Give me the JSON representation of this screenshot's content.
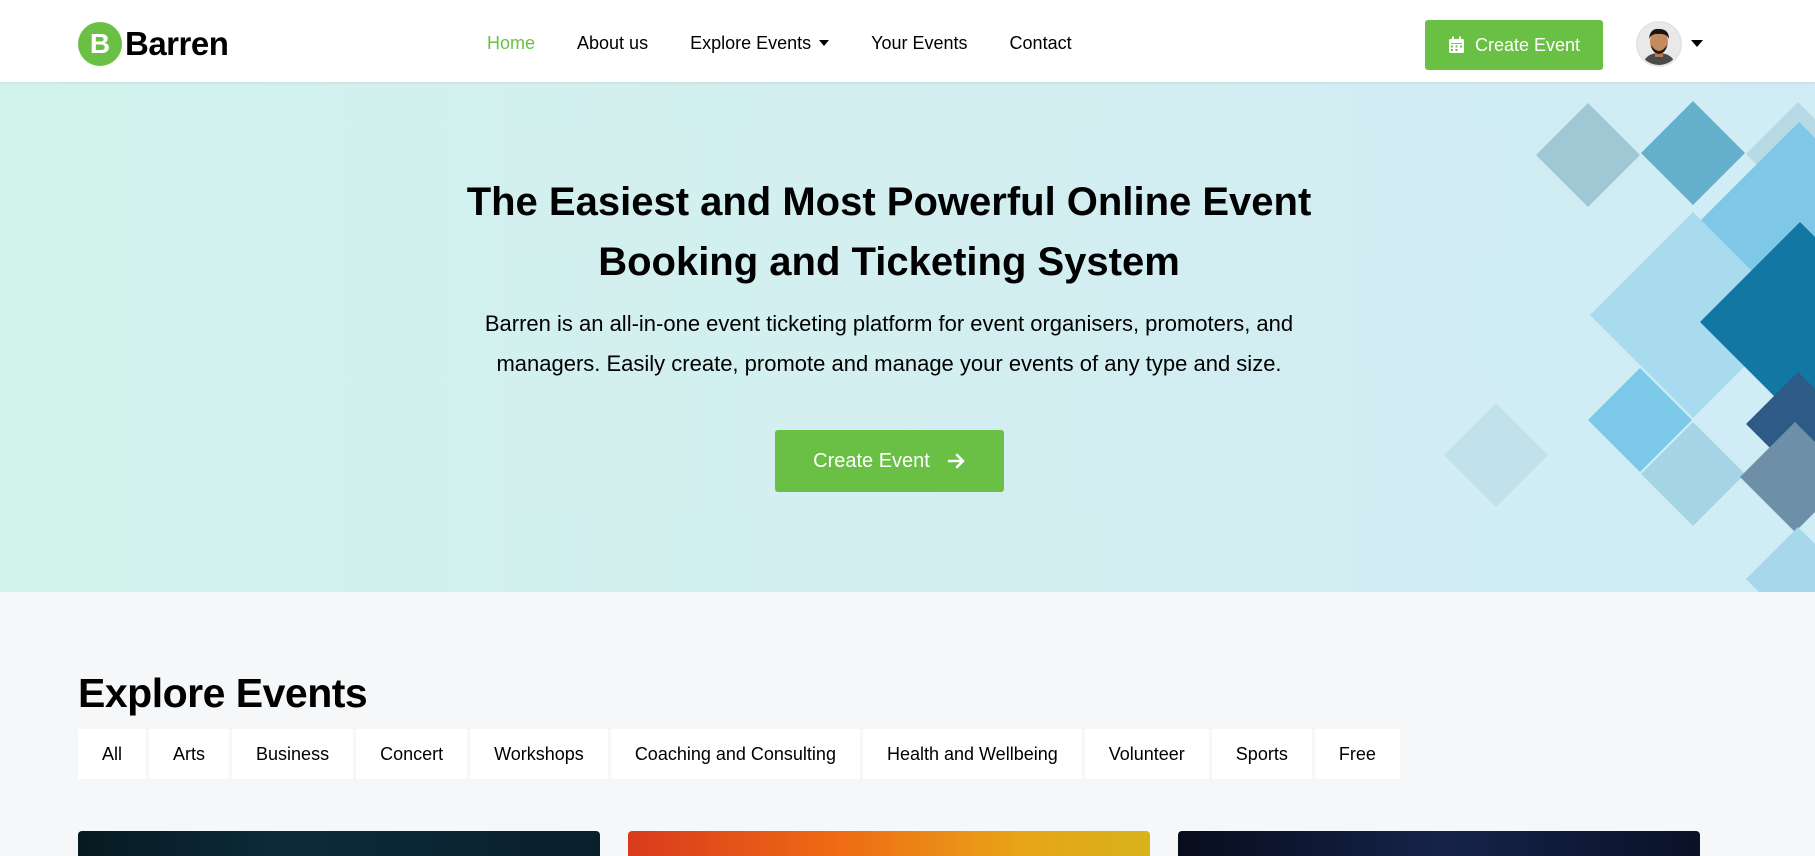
{
  "brand": {
    "logo_letter": "B",
    "name": "Barren",
    "accent": "#6ac045"
  },
  "nav": {
    "items": [
      {
        "label": "Home",
        "active": true
      },
      {
        "label": "About us"
      },
      {
        "label": "Explore Events",
        "dropdown": true
      },
      {
        "label": "Your Events"
      },
      {
        "label": "Contact"
      }
    ]
  },
  "header": {
    "create_label": "Create Event",
    "create_icon": "calendar-icon",
    "avatar": "user-avatar"
  },
  "hero": {
    "title_line1": "The Easiest and Most Powerful Online Event",
    "title_line2": "Booking and Ticketing System",
    "desc_line1": "Barren is an all-in-one event ticketing platform for event organisers, promoters, and",
    "desc_line2": "managers. Easily create, promote and manage your events of any type and size.",
    "cta_label": "Create Event",
    "cta_icon": "arrow-right-icon"
  },
  "explore": {
    "title": "Explore Events",
    "tabs": [
      "All",
      "Arts",
      "Business",
      "Concert",
      "Workshops",
      "Coaching and Consulting",
      "Health and Wellbeing",
      "Volunteer",
      "Sports",
      "Free"
    ]
  }
}
